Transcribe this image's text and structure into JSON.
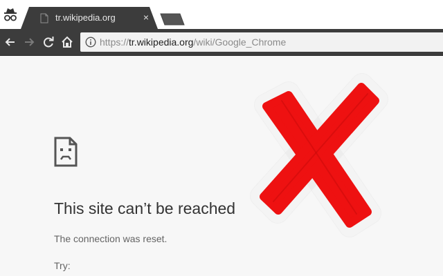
{
  "tab": {
    "title": "tr.wikipedia.org"
  },
  "tab_close_glyph": "×",
  "omnibox": {
    "scheme": "https://",
    "host": "tr.wikipedia.org",
    "path": "/wiki/Google_Chrome"
  },
  "icons": {
    "incognito": "incognito-icon",
    "back": "back-arrow-icon",
    "forward": "forward-arrow-icon",
    "reload": "reload-icon",
    "home": "home-icon",
    "info": "info-icon",
    "sad_page": "sad-page-icon",
    "overlay": "red-x-icon"
  },
  "error": {
    "title": "This site can’t be reached",
    "detail": "The connection was reset.",
    "try_label": "Try:"
  },
  "colors": {
    "toolbar": "#3c3c3c",
    "omnibox_bg": "#f2f2f2",
    "page_bg": "#f7f7f7",
    "overlay_red": "#ee1111"
  }
}
